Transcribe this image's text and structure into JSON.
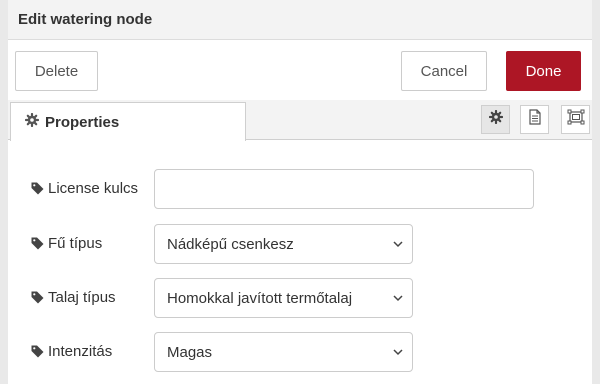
{
  "dialog": {
    "title": "Edit watering node"
  },
  "buttons": {
    "delete": "Delete",
    "cancel": "Cancel",
    "done": "Done"
  },
  "colors": {
    "done_bg": "#ad1625",
    "frame": "#e9e9e9",
    "header_bg": "#f3f3f3"
  },
  "tabs": [
    {
      "label": "Properties",
      "icon": "gear-icon"
    }
  ],
  "toolbar_icons": [
    "gear-icon",
    "document-icon",
    "frame-icon"
  ],
  "form": {
    "license": {
      "label": "License kulcs",
      "value": ""
    },
    "grass": {
      "label": "Fű típus",
      "value": "Nádképű csenkesz"
    },
    "soil": {
      "label": "Talaj típus",
      "value": "Homokkal javított termőtalaj"
    },
    "intensity": {
      "label": "Intenzitás",
      "value": "Magas"
    }
  }
}
